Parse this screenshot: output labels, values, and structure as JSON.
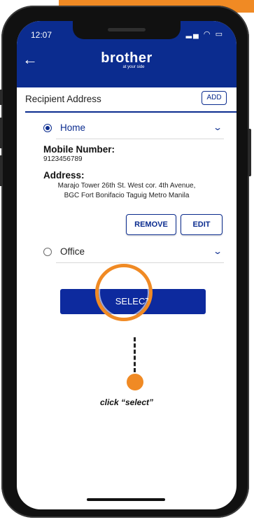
{
  "status_bar": {
    "time": "12:07"
  },
  "header": {
    "logo_text": "brother",
    "logo_tagline": "at your side"
  },
  "recipient": {
    "section_title": "Recipient Address",
    "add_label": "ADD",
    "addresses": [
      {
        "name": "Home",
        "selected": true,
        "expanded": true,
        "mobile_label": "Mobile Number:",
        "mobile_value": "9123456789",
        "address_label": "Address:",
        "address_line1": "Marajo Tower 26th St. West cor. 4th Avenue,",
        "address_line2": "BGC Fort Bonifacio Taguig Metro Manila",
        "remove_label": "REMOVE",
        "edit_label": "EDIT"
      },
      {
        "name": "Office",
        "selected": false,
        "expanded": false
      }
    ],
    "select_label": "SELECT"
  },
  "annotation": {
    "hint_text": "click “select”"
  },
  "colors": {
    "primary": "#0b2c8f",
    "accent": "#f08a24"
  },
  "icons": {
    "back": "arrow-left-icon",
    "chevron": "chevron-down-icon",
    "signal": "signal-icon",
    "wifi": "wifi-icon",
    "battery": "battery-icon"
  }
}
